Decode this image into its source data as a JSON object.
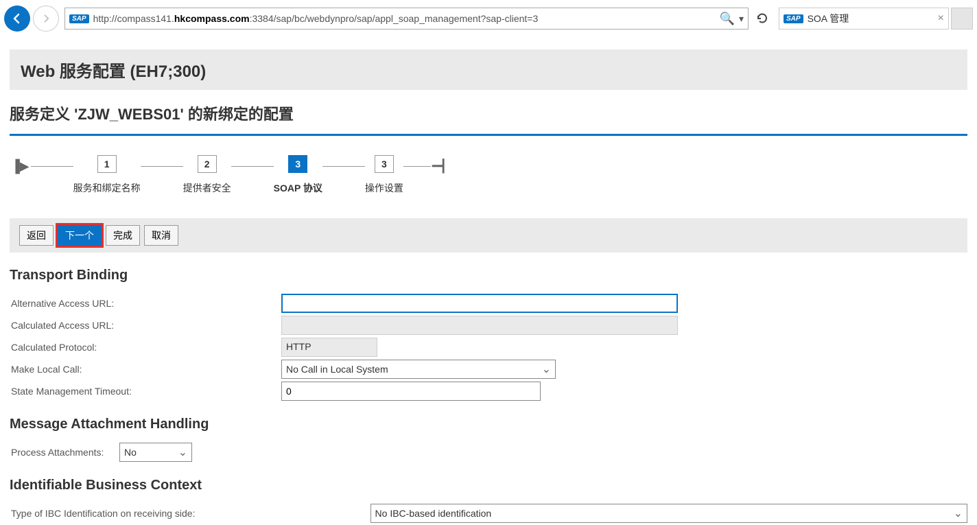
{
  "browser": {
    "url_pre": "http://compass141.",
    "url_bold": "hkcompass.com",
    "url_post": ":3384/sap/bc/webdynpro/sap/appl_soap_management?sap-client=3",
    "tab_title": "SOA 管理"
  },
  "page": {
    "title": "Web 服务配置 (EH7;300)",
    "subtitle": "服务定义 'ZJW_WEBS01' 的新绑定的配置"
  },
  "wizard": {
    "steps": [
      {
        "num": "1",
        "label": "服务和绑定名称"
      },
      {
        "num": "2",
        "label": "提供者安全"
      },
      {
        "num": "3",
        "label": "SOAP 协议"
      },
      {
        "num": "3",
        "label": "操作设置"
      }
    ],
    "active_index": 2
  },
  "buttons": {
    "back": "返回",
    "next": "下一个",
    "finish": "完成",
    "cancel": "取消"
  },
  "transport": {
    "title": "Transport Binding",
    "alt_url_label": "Alternative Access URL:",
    "alt_url_value": "",
    "calc_url_label": "Calculated Access URL:",
    "calc_url_value": "",
    "calc_proto_label": "Calculated Protocol:",
    "calc_proto_value": "HTTP",
    "local_call_label": "Make Local Call:",
    "local_call_value": "No Call in Local System",
    "timeout_label": "State Management Timeout:",
    "timeout_value": "0"
  },
  "attach": {
    "title": "Message Attachment Handling",
    "process_label": "Process Attachments:",
    "process_value": "No"
  },
  "ibc": {
    "title": "Identifiable Business Context",
    "type_label": "Type of IBC Identification on receiving side:",
    "type_value": "No IBC-based identification"
  }
}
